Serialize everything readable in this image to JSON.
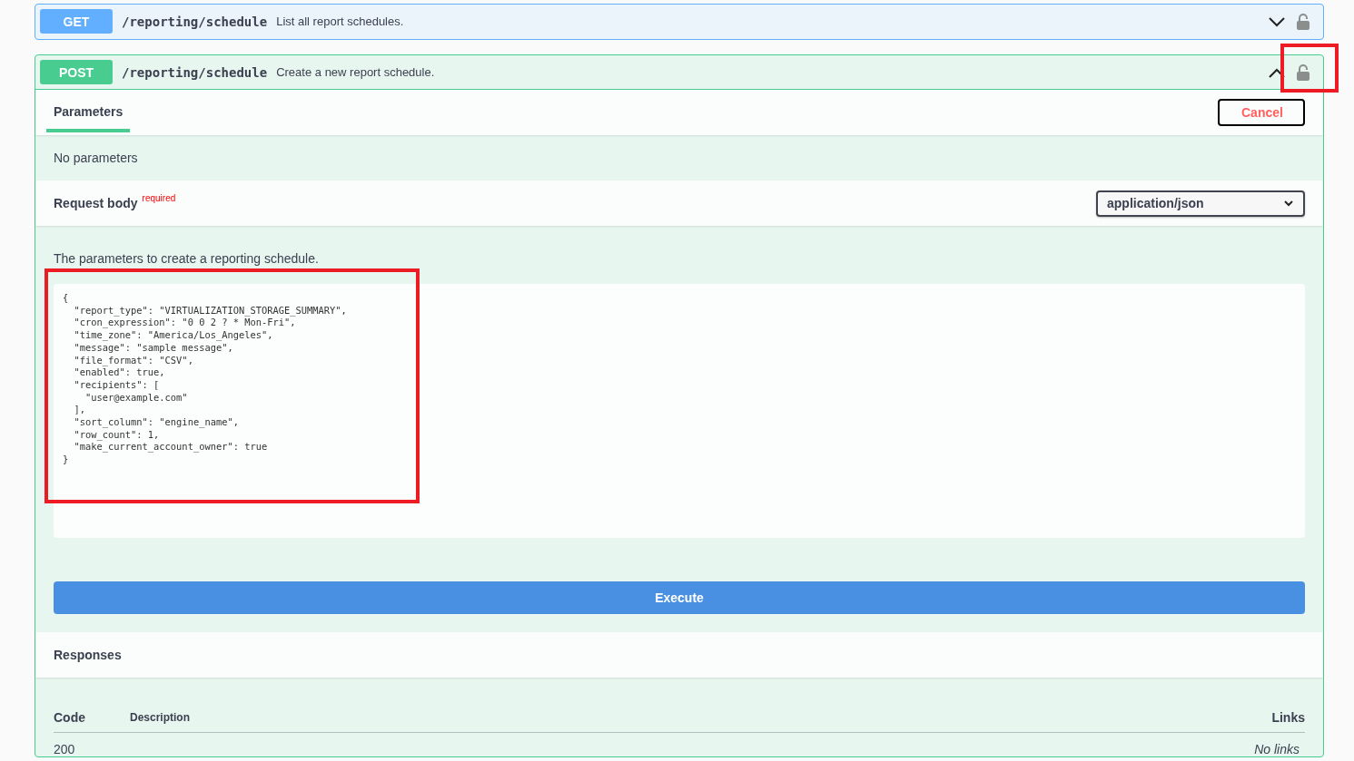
{
  "operations": [
    {
      "method": "GET",
      "path": "/reporting/schedule",
      "summary": "List all report schedules.",
      "expanded": false,
      "lock_highlighted": false
    },
    {
      "method": "POST",
      "path": "/reporting/schedule",
      "summary": "Create a new report schedule.",
      "expanded": true,
      "lock_highlighted": true
    }
  ],
  "parameters": {
    "tab": "Parameters",
    "cancel": "Cancel",
    "empty": "No parameters"
  },
  "request_body": {
    "title": "Request body",
    "required": "required",
    "content_type": "application/json",
    "description": "The parameters to create a reporting schedule.",
    "highlighted": true,
    "code": "{\n  \"report_type\": \"VIRTUALIZATION_STORAGE_SUMMARY\",\n  \"cron_expression\": \"0 0 2 ? * Mon-Fri\",\n  \"time_zone\": \"America/Los_Angeles\",\n  \"message\": \"sample message\",\n  \"file_format\": \"CSV\",\n  \"enabled\": true,\n  \"recipients\": [\n    \"user@example.com\"\n  ],\n  \"sort_column\": \"engine_name\",\n  \"row_count\": 1,\n  \"make_current_account_owner\": true\n}"
  },
  "execute": "Execute",
  "responses": {
    "title": "Responses",
    "columns": [
      "Code",
      "Description",
      "Links"
    ],
    "rows": [
      {
        "code": "200",
        "links": "No links"
      }
    ]
  }
}
